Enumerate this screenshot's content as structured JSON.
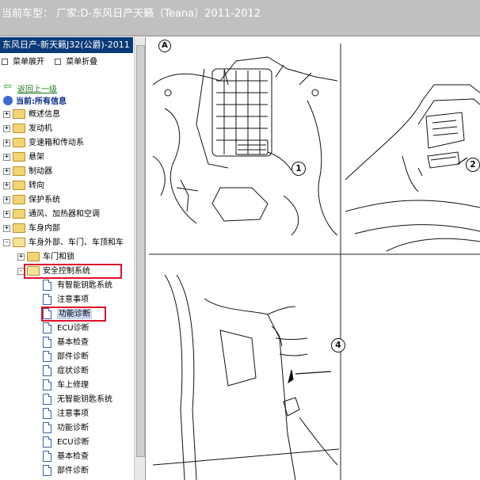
{
  "titlebar": {
    "text": "当前车型：  厂家:D-东风日产天籁（Teana）2011-2012"
  },
  "left_pane": {
    "header": "东风日产-新天籁J32(公爵)-2011",
    "menu": [
      {
        "label": "菜单展开"
      },
      {
        "label": "菜单折叠"
      }
    ],
    "nav_up": "返回上一级",
    "current": "当前:所有信息",
    "tree": [
      {
        "label": "概述信息",
        "type": "folder",
        "expander": "+"
      },
      {
        "label": "发动机",
        "type": "folder",
        "expander": "+"
      },
      {
        "label": "变速箱和传动系",
        "type": "folder",
        "expander": "+"
      },
      {
        "label": "悬架",
        "type": "folder",
        "expander": "+"
      },
      {
        "label": "制动器",
        "type": "folder",
        "expander": "+"
      },
      {
        "label": "转向",
        "type": "folder",
        "expander": "+"
      },
      {
        "label": "保护系统",
        "type": "folder",
        "expander": "+"
      },
      {
        "label": "通风、加热器和空调",
        "type": "folder",
        "expander": "+"
      },
      {
        "label": "车身内部",
        "type": "folder",
        "expander": "+"
      },
      {
        "label": "车身外部、车门、车顶和车",
        "type": "folder",
        "expander": "-"
      },
      {
        "label": "车门和锁",
        "type": "folder",
        "expander": "+"
      },
      {
        "label": "安全控制系统",
        "type": "folder",
        "expander": "-",
        "highlighted": true
      },
      {
        "label": "有智能钥匙系统",
        "type": "doc"
      },
      {
        "label": "注意事项",
        "type": "doc"
      },
      {
        "label": "功能诊断",
        "type": "doc",
        "selected": true,
        "highlighted": true
      },
      {
        "label": "ECU诊断",
        "type": "doc"
      },
      {
        "label": "基本检查",
        "type": "doc"
      },
      {
        "label": "部件诊断",
        "type": "doc"
      },
      {
        "label": "症状诊断",
        "type": "doc"
      },
      {
        "label": "车上修理",
        "type": "doc"
      },
      {
        "label": "无智能钥匙系统",
        "type": "doc"
      },
      {
        "label": "注意事项",
        "type": "doc"
      },
      {
        "label": "功能诊断",
        "type": "doc"
      },
      {
        "label": "ECU诊断",
        "type": "doc"
      },
      {
        "label": "基本检查",
        "type": "doc"
      },
      {
        "label": "部件诊断",
        "type": "doc"
      }
    ]
  },
  "viewer": {
    "panel_label": "A",
    "callouts": [
      "1",
      "2",
      "4"
    ]
  },
  "colors": {
    "titlebar_bg": "#c0c0c0",
    "header_bg": "#0a3a78",
    "highlight_box": "#e0102a",
    "nav_green": "#1c7a1c"
  }
}
